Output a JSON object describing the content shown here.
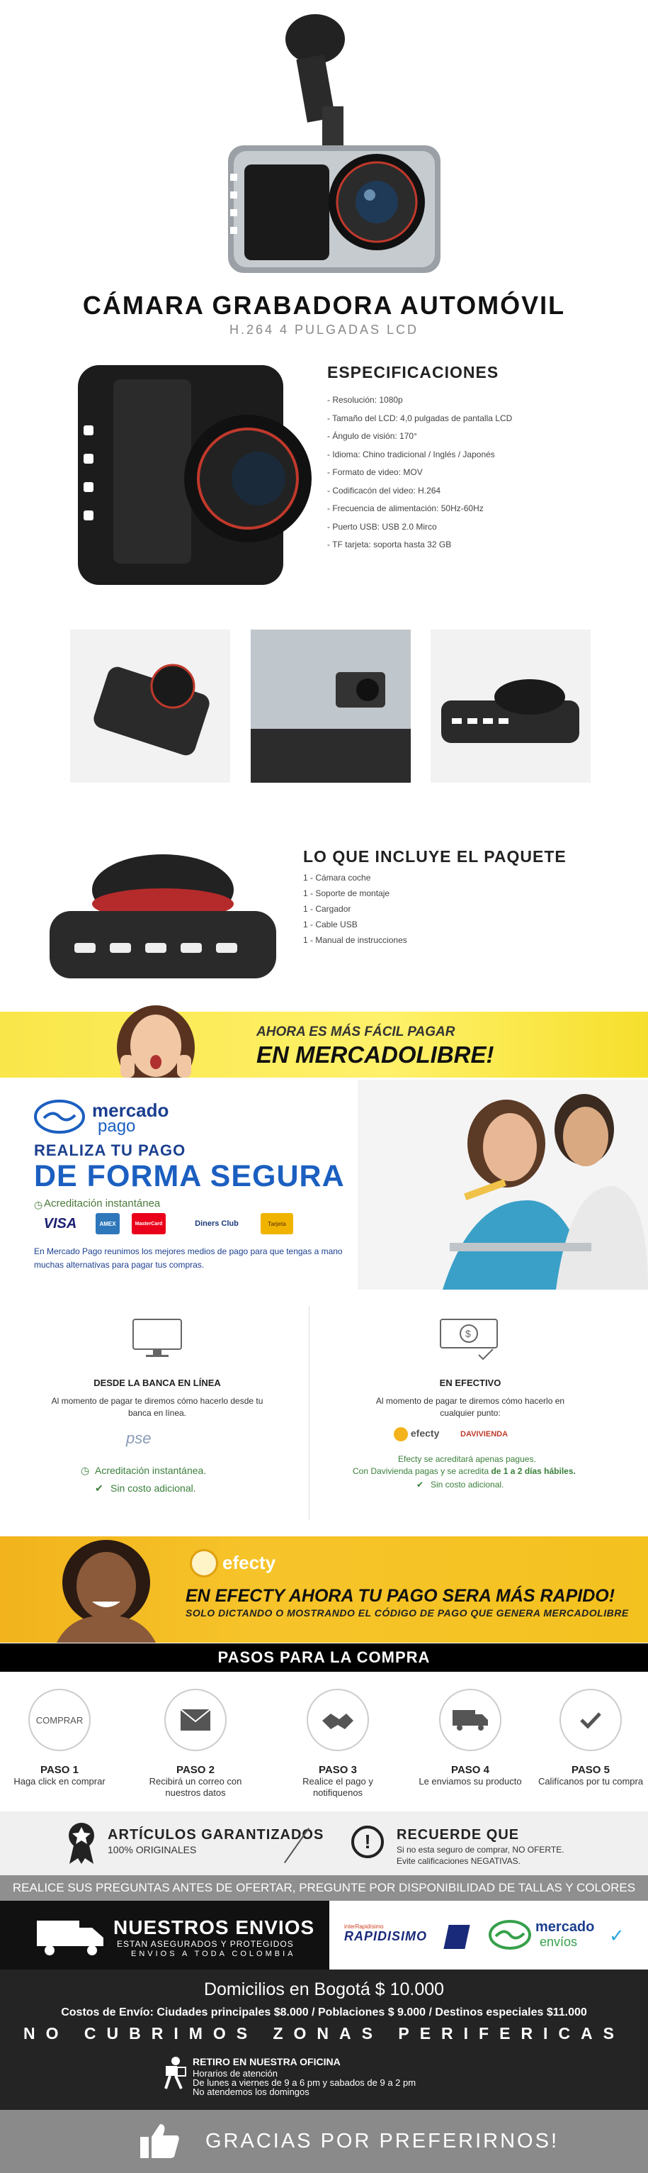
{
  "product": {
    "title": "CÁMARA GRABADORA AUTOMÓVIL",
    "subtitle": "H.264 4 PULGADAS LCD"
  },
  "specs": {
    "heading": "ESPECIFICACIONES",
    "items": [
      "- Resolución: 1080p",
      "- Tamaño del LCD: 4,0 pulgadas de pantalla LCD",
      "- Ángulo de visión: 170°",
      "- Idioma: Chino tradicional / Inglés / Japonés",
      "- Formato de video: MOV",
      "- Codificacón del video: H.264",
      "- Frecuencia de alimentación: 50Hz-60Hz",
      "- Puerto USB: USB 2.0 Mirco",
      "- TF tarjeta: soporta hasta 32 GB"
    ]
  },
  "package": {
    "heading": "LO QUE INCLUYE EL PAQUETE",
    "items": [
      "1 - Cámara coche",
      "1 - Soporte de montaje",
      "1 - Cargador",
      "1 - Cable USB",
      "1 - Manual de instrucciones"
    ]
  },
  "ml_banner": {
    "line1": "AHORA ES MÁS FÁCIL PAGAR",
    "line2": "EN MERCADOLIBRE!"
  },
  "mercadopago": {
    "logo_top": "mercado",
    "logo_bottom": "pago",
    "realiza": "REALIZA TU PAGO",
    "forma": "DE FORMA SEGURA",
    "acreditacion": "Acreditación instantánea",
    "cards": [
      "VISA",
      "AMEX",
      "MasterCard",
      "Diners Club",
      "Tarjeta"
    ],
    "description": "En Mercado Pago reunimos los mejores medios de pago para que tengas a mano muchas alternativas para pagar tus compras."
  },
  "payment": {
    "banca": {
      "heading": "DESDE LA BANCA EN LÍNEA",
      "text": "Al momento de pagar te diremos cómo hacerlo desde tu banca en línea.",
      "logo": "pse",
      "check1": "Acreditación instantánea.",
      "check2": "Sin costo adicional."
    },
    "efectivo": {
      "heading": "EN EFECTIVO",
      "text": "Al momento de pagar te diremos cómo hacerlo en cualquier punto:",
      "logo1": "efecty",
      "logo2": "DAVIVIENDA",
      "note1": "Efecty se acreditará apenas pagues.",
      "note2a": "Con Davivienda pagas y se acredita ",
      "note2b": "de 1 a 2 días hábiles.",
      "note3": "Sin costo adicional."
    }
  },
  "efecty_banner": {
    "logo": "efecty",
    "line1": "EN EFECTY AHORA TU PAGO SERA MÁS RAPIDO!",
    "line2": "SOLO DICTANDO O MOSTRANDO EL CÓDIGO DE PAGO QUE GENERA MERCADOLIBRE"
  },
  "steps": {
    "heading": "PASOS PARA LA COMPRA",
    "items": [
      {
        "icon_text": "COMPRAR",
        "num": "PASO 1",
        "desc": "Haga click en comprar"
      },
      {
        "icon_text": "",
        "num": "PASO 2",
        "desc": "Recibirá un correo con nuestros datos"
      },
      {
        "icon_text": "",
        "num": "PASO 3",
        "desc": "Realice el pago y notifiquenos"
      },
      {
        "icon_text": "",
        "num": "PASO 4",
        "desc": "Le enviamos su producto"
      },
      {
        "icon_text": "",
        "num": "PASO 5",
        "desc": "Califícanos por tu compra"
      }
    ]
  },
  "guarantee": {
    "title": "ARTÍCULOS GARANTIZADOS",
    "sub": "100% ORIGINALES",
    "recuerde_title": "RECUERDE QUE",
    "recuerde_line1": "Si no esta seguro de comprar, NO OFERTE.",
    "recuerde_line2": "Evite calificaciones NEGATIVAS."
  },
  "notice": "REALICE SUS PREGUNTAS ANTES DE OFERTAR, PREGUNTE POR DISPONIBILIDAD DE TALLAS Y COLORES",
  "shipping": {
    "title": "NUESTROS ENVIOS",
    "sub1": "ESTAN ASEGURADOS Y PROTEGIDOS",
    "sub2": "ENVIOS A TODA COLOMBIA",
    "rapidisimo": "RAPIDISIMO",
    "rapidisimo_top": "interRapidísimo",
    "me_top": "mercado",
    "me_bottom": "envíos"
  },
  "domicilios": {
    "line1": "Domicilios en Bogotá $ 10.000",
    "line2": "Costos de Envío: Ciudades principales $8.000 / Poblaciones $ 9.000 / Destinos especiales $11.000",
    "line3": "NO CUBRIMOS ZONAS PERIFERICAS",
    "office_title": "RETIRO EN NUESTRA OFICINA",
    "office_1": "Horarios de atención",
    "office_2": "De lunes a viernes de 9 a 6 pm y sabados de 9 a 2 pm",
    "office_3": "No atendemos los domingos"
  },
  "thanks": "GRACIAS POR PREFERIRNOS!"
}
